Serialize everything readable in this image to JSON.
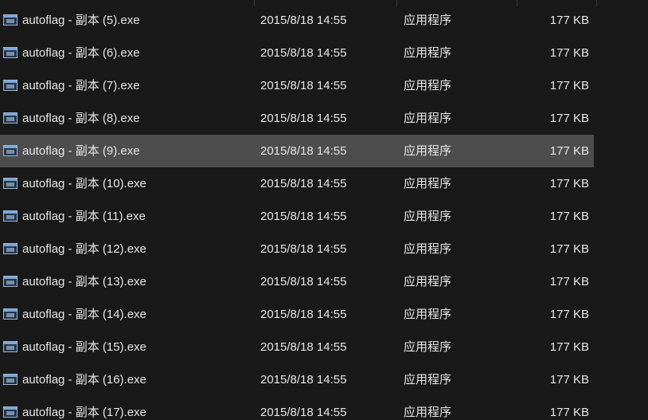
{
  "files": [
    {
      "name": "autoflag - 副本 (5).exe",
      "date": "2015/8/18 14:55",
      "type": "应用程序",
      "size": "177 KB",
      "icon": "exe-file-icon"
    },
    {
      "name": "autoflag - 副本 (6).exe",
      "date": "2015/8/18 14:55",
      "type": "应用程序",
      "size": "177 KB",
      "icon": "exe-file-icon"
    },
    {
      "name": "autoflag - 副本 (7).exe",
      "date": "2015/8/18 14:55",
      "type": "应用程序",
      "size": "177 KB",
      "icon": "exe-file-icon"
    },
    {
      "name": "autoflag - 副本 (8).exe",
      "date": "2015/8/18 14:55",
      "type": "应用程序",
      "size": "177 KB",
      "icon": "exe-file-icon"
    },
    {
      "name": "autoflag - 副本 (9).exe",
      "date": "2015/8/18 14:55",
      "type": "应用程序",
      "size": "177 KB",
      "icon": "exe-file-icon",
      "selected": true
    },
    {
      "name": "autoflag - 副本 (10).exe",
      "date": "2015/8/18 14:55",
      "type": "应用程序",
      "size": "177 KB",
      "icon": "exe-file-icon"
    },
    {
      "name": "autoflag - 副本 (11).exe",
      "date": "2015/8/18 14:55",
      "type": "应用程序",
      "size": "177 KB",
      "icon": "exe-file-icon"
    },
    {
      "name": "autoflag - 副本 (12).exe",
      "date": "2015/8/18 14:55",
      "type": "应用程序",
      "size": "177 KB",
      "icon": "exe-file-icon"
    },
    {
      "name": "autoflag - 副本 (13).exe",
      "date": "2015/8/18 14:55",
      "type": "应用程序",
      "size": "177 KB",
      "icon": "exe-file-icon"
    },
    {
      "name": "autoflag - 副本 (14).exe",
      "date": "2015/8/18 14:55",
      "type": "应用程序",
      "size": "177 KB",
      "icon": "exe-file-icon"
    },
    {
      "name": "autoflag - 副本 (15).exe",
      "date": "2015/8/18 14:55",
      "type": "应用程序",
      "size": "177 KB",
      "icon": "exe-file-icon"
    },
    {
      "name": "autoflag - 副本 (16).exe",
      "date": "2015/8/18 14:55",
      "type": "应用程序",
      "size": "177 KB",
      "icon": "exe-file-icon"
    },
    {
      "name": "autoflag - 副本 (17).exe",
      "date": "2015/8/18 14:55",
      "type": "应用程序",
      "size": "177 KB",
      "icon": "exe-file-icon"
    }
  ],
  "colors": {
    "background": "#191919",
    "text": "#e6e6e6",
    "selected_row": "#4d4d4d"
  }
}
